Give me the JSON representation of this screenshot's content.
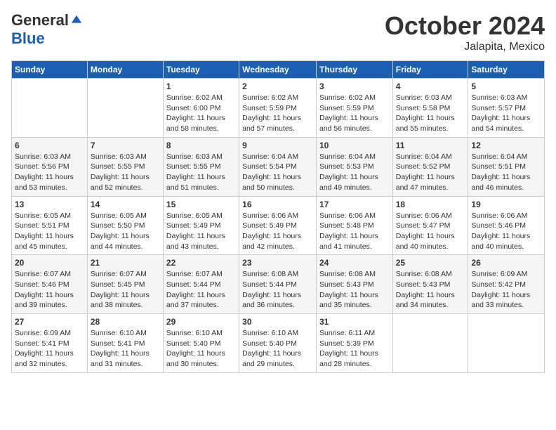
{
  "logo": {
    "general": "General",
    "blue": "Blue"
  },
  "header": {
    "month": "October 2024",
    "location": "Jalapita, Mexico"
  },
  "days_of_week": [
    "Sunday",
    "Monday",
    "Tuesday",
    "Wednesday",
    "Thursday",
    "Friday",
    "Saturday"
  ],
  "weeks": [
    [
      {
        "day": "",
        "sunrise": "",
        "sunset": "",
        "daylight": ""
      },
      {
        "day": "",
        "sunrise": "",
        "sunset": "",
        "daylight": ""
      },
      {
        "day": "1",
        "sunrise": "Sunrise: 6:02 AM",
        "sunset": "Sunset: 6:00 PM",
        "daylight": "Daylight: 11 hours and 58 minutes."
      },
      {
        "day": "2",
        "sunrise": "Sunrise: 6:02 AM",
        "sunset": "Sunset: 5:59 PM",
        "daylight": "Daylight: 11 hours and 57 minutes."
      },
      {
        "day": "3",
        "sunrise": "Sunrise: 6:02 AM",
        "sunset": "Sunset: 5:59 PM",
        "daylight": "Daylight: 11 hours and 56 minutes."
      },
      {
        "day": "4",
        "sunrise": "Sunrise: 6:03 AM",
        "sunset": "Sunset: 5:58 PM",
        "daylight": "Daylight: 11 hours and 55 minutes."
      },
      {
        "day": "5",
        "sunrise": "Sunrise: 6:03 AM",
        "sunset": "Sunset: 5:57 PM",
        "daylight": "Daylight: 11 hours and 54 minutes."
      }
    ],
    [
      {
        "day": "6",
        "sunrise": "Sunrise: 6:03 AM",
        "sunset": "Sunset: 5:56 PM",
        "daylight": "Daylight: 11 hours and 53 minutes."
      },
      {
        "day": "7",
        "sunrise": "Sunrise: 6:03 AM",
        "sunset": "Sunset: 5:55 PM",
        "daylight": "Daylight: 11 hours and 52 minutes."
      },
      {
        "day": "8",
        "sunrise": "Sunrise: 6:03 AM",
        "sunset": "Sunset: 5:55 PM",
        "daylight": "Daylight: 11 hours and 51 minutes."
      },
      {
        "day": "9",
        "sunrise": "Sunrise: 6:04 AM",
        "sunset": "Sunset: 5:54 PM",
        "daylight": "Daylight: 11 hours and 50 minutes."
      },
      {
        "day": "10",
        "sunrise": "Sunrise: 6:04 AM",
        "sunset": "Sunset: 5:53 PM",
        "daylight": "Daylight: 11 hours and 49 minutes."
      },
      {
        "day": "11",
        "sunrise": "Sunrise: 6:04 AM",
        "sunset": "Sunset: 5:52 PM",
        "daylight": "Daylight: 11 hours and 47 minutes."
      },
      {
        "day": "12",
        "sunrise": "Sunrise: 6:04 AM",
        "sunset": "Sunset: 5:51 PM",
        "daylight": "Daylight: 11 hours and 46 minutes."
      }
    ],
    [
      {
        "day": "13",
        "sunrise": "Sunrise: 6:05 AM",
        "sunset": "Sunset: 5:51 PM",
        "daylight": "Daylight: 11 hours and 45 minutes."
      },
      {
        "day": "14",
        "sunrise": "Sunrise: 6:05 AM",
        "sunset": "Sunset: 5:50 PM",
        "daylight": "Daylight: 11 hours and 44 minutes."
      },
      {
        "day": "15",
        "sunrise": "Sunrise: 6:05 AM",
        "sunset": "Sunset: 5:49 PM",
        "daylight": "Daylight: 11 hours and 43 minutes."
      },
      {
        "day": "16",
        "sunrise": "Sunrise: 6:06 AM",
        "sunset": "Sunset: 5:49 PM",
        "daylight": "Daylight: 11 hours and 42 minutes."
      },
      {
        "day": "17",
        "sunrise": "Sunrise: 6:06 AM",
        "sunset": "Sunset: 5:48 PM",
        "daylight": "Daylight: 11 hours and 41 minutes."
      },
      {
        "day": "18",
        "sunrise": "Sunrise: 6:06 AM",
        "sunset": "Sunset: 5:47 PM",
        "daylight": "Daylight: 11 hours and 40 minutes."
      },
      {
        "day": "19",
        "sunrise": "Sunrise: 6:06 AM",
        "sunset": "Sunset: 5:46 PM",
        "daylight": "Daylight: 11 hours and 40 minutes."
      }
    ],
    [
      {
        "day": "20",
        "sunrise": "Sunrise: 6:07 AM",
        "sunset": "Sunset: 5:46 PM",
        "daylight": "Daylight: 11 hours and 39 minutes."
      },
      {
        "day": "21",
        "sunrise": "Sunrise: 6:07 AM",
        "sunset": "Sunset: 5:45 PM",
        "daylight": "Daylight: 11 hours and 38 minutes."
      },
      {
        "day": "22",
        "sunrise": "Sunrise: 6:07 AM",
        "sunset": "Sunset: 5:44 PM",
        "daylight": "Daylight: 11 hours and 37 minutes."
      },
      {
        "day": "23",
        "sunrise": "Sunrise: 6:08 AM",
        "sunset": "Sunset: 5:44 PM",
        "daylight": "Daylight: 11 hours and 36 minutes."
      },
      {
        "day": "24",
        "sunrise": "Sunrise: 6:08 AM",
        "sunset": "Sunset: 5:43 PM",
        "daylight": "Daylight: 11 hours and 35 minutes."
      },
      {
        "day": "25",
        "sunrise": "Sunrise: 6:08 AM",
        "sunset": "Sunset: 5:43 PM",
        "daylight": "Daylight: 11 hours and 34 minutes."
      },
      {
        "day": "26",
        "sunrise": "Sunrise: 6:09 AM",
        "sunset": "Sunset: 5:42 PM",
        "daylight": "Daylight: 11 hours and 33 minutes."
      }
    ],
    [
      {
        "day": "27",
        "sunrise": "Sunrise: 6:09 AM",
        "sunset": "Sunset: 5:41 PM",
        "daylight": "Daylight: 11 hours and 32 minutes."
      },
      {
        "day": "28",
        "sunrise": "Sunrise: 6:10 AM",
        "sunset": "Sunset: 5:41 PM",
        "daylight": "Daylight: 11 hours and 31 minutes."
      },
      {
        "day": "29",
        "sunrise": "Sunrise: 6:10 AM",
        "sunset": "Sunset: 5:40 PM",
        "daylight": "Daylight: 11 hours and 30 minutes."
      },
      {
        "day": "30",
        "sunrise": "Sunrise: 6:10 AM",
        "sunset": "Sunset: 5:40 PM",
        "daylight": "Daylight: 11 hours and 29 minutes."
      },
      {
        "day": "31",
        "sunrise": "Sunrise: 6:11 AM",
        "sunset": "Sunset: 5:39 PM",
        "daylight": "Daylight: 11 hours and 28 minutes."
      },
      {
        "day": "",
        "sunrise": "",
        "sunset": "",
        "daylight": ""
      },
      {
        "day": "",
        "sunrise": "",
        "sunset": "",
        "daylight": ""
      }
    ]
  ]
}
